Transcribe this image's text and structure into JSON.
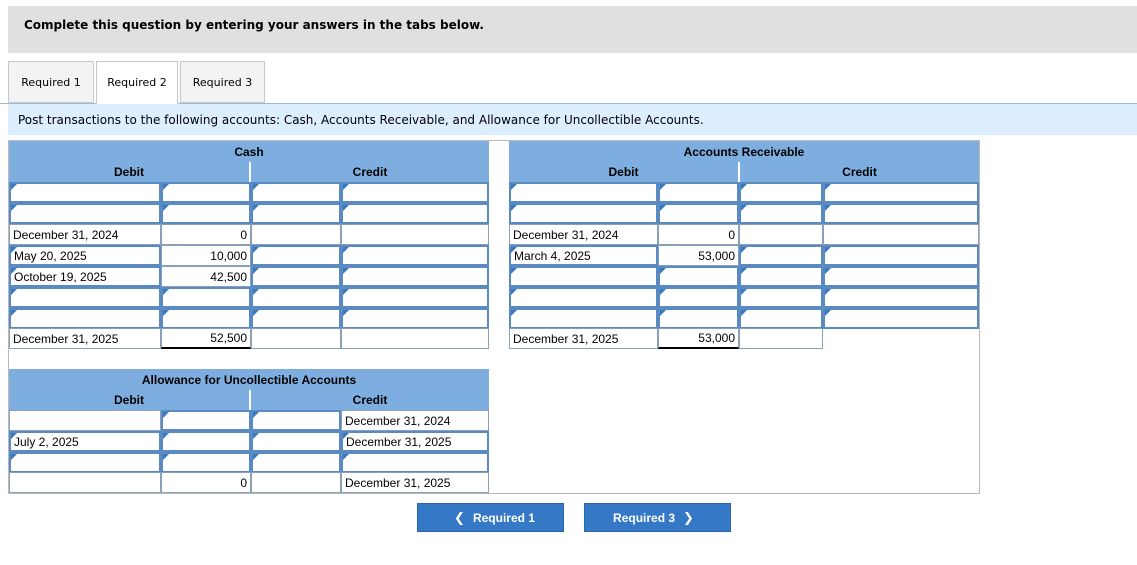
{
  "header": {
    "text": "Complete this question by entering your answers in the tabs below."
  },
  "tabs": [
    {
      "label": "Required 1"
    },
    {
      "label": "Required 2"
    },
    {
      "label": "Required 3"
    }
  ],
  "instruction": "Post transactions to the following accounts: Cash, Accounts Receivable, and Allowance for Uncollectible Accounts.",
  "cash": {
    "title": "Cash",
    "debit": "Debit",
    "credit": "Credit",
    "rows": [
      {
        "date": "December 31, 2024",
        "amount": "0"
      },
      {
        "date": "May 20, 2025",
        "amount": "10,000"
      },
      {
        "date": "October 19, 2025",
        "amount": "42,500"
      },
      {
        "date": "December 31, 2025",
        "amount": "52,500"
      }
    ]
  },
  "accounts_receivable": {
    "title": "Accounts Receivable",
    "debit": "Debit",
    "credit": "Credit",
    "rows": [
      {
        "date": "December 31, 2024",
        "amount": "0"
      },
      {
        "date": "March 4, 2025",
        "amount": "53,000"
      },
      {
        "date": "December 31, 2025",
        "amount": "53,000"
      }
    ]
  },
  "allowance": {
    "title": "Allowance for Uncollectible Accounts",
    "debit": "Debit",
    "credit": "Credit",
    "credit_dates": [
      "December 31, 2024",
      "December 31, 2025",
      "December 31, 2025"
    ],
    "debit_date": "July 2, 2025",
    "balance": "0"
  },
  "nav": {
    "prev_label": "Required 1",
    "next_label": "Required 3",
    "prev_icon": "chevron-left-icon",
    "next_icon": "chevron-right-icon"
  },
  "colors": {
    "header_blue": "#7eaee0",
    "button_blue": "#3478c6",
    "instruction_bg": "#ddeeff"
  }
}
